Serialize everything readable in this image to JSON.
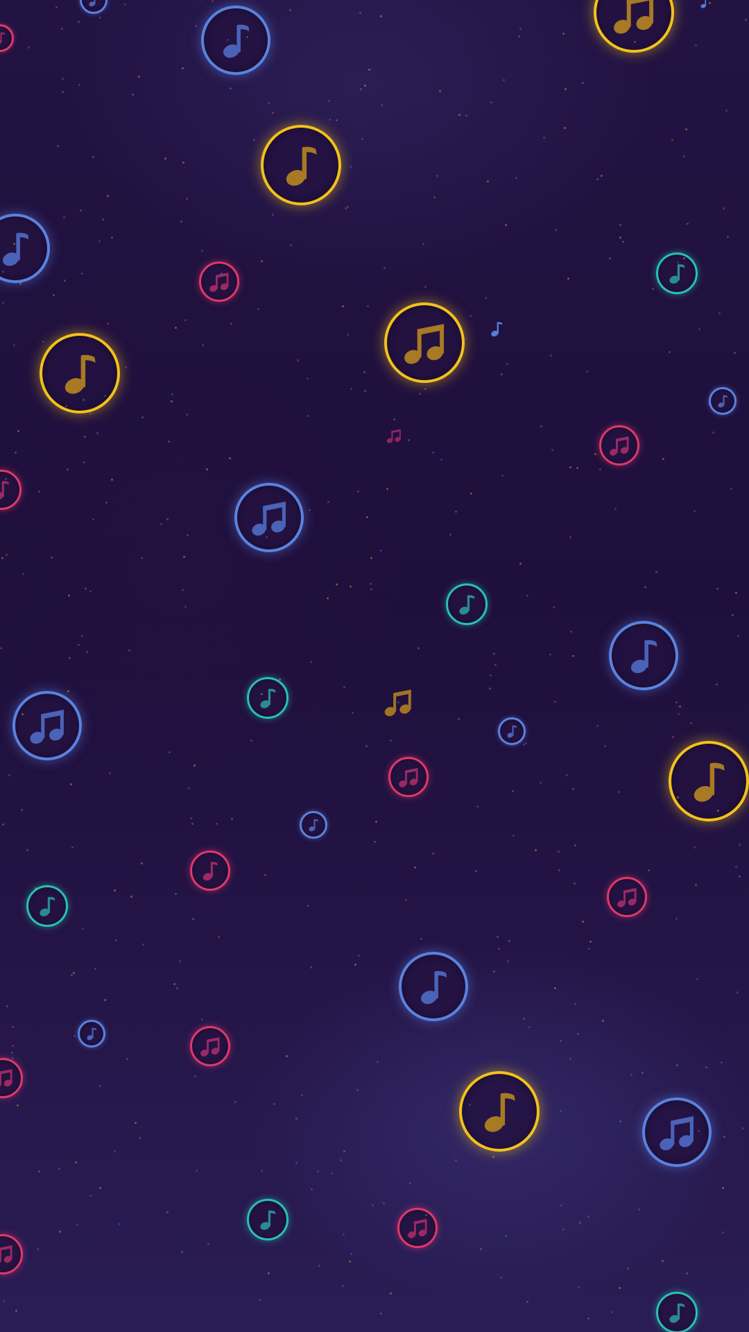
{
  "screen": {
    "description_free": true
  },
  "palette": {
    "background_top": "#231343",
    "background_bottom": "#2a1d55",
    "yellow_ring": "#f2c21c",
    "yellow_note": "#a77a23",
    "blue_ring": "#5a82e0",
    "blue_note": "#4a63b8",
    "pink_ring": "#e0386a",
    "pink_note": "#9b2a63",
    "teal_ring": "#27c2b3",
    "teal_note": "#2a8b91"
  },
  "icons": {
    "single_note": "eighth-note-icon",
    "double_note": "beamed-eighth-notes-icon"
  }
}
